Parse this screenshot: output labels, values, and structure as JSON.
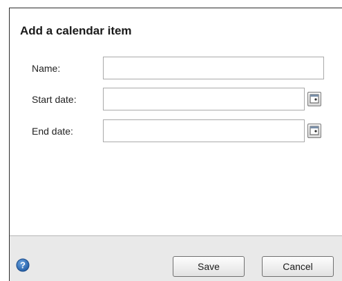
{
  "dialog": {
    "title": "Add a calendar item",
    "fields": {
      "name": {
        "label": "Name:",
        "value": ""
      },
      "start_date": {
        "label": "Start date:",
        "value": ""
      },
      "end_date": {
        "label": "End date:",
        "value": ""
      }
    },
    "buttons": {
      "save": "Save",
      "cancel": "Cancel"
    },
    "icons": {
      "help": "help-icon",
      "calendar": "calendar-icon"
    },
    "colors": {
      "footer": "#e9e9e9",
      "help_icon": "#2f6fb6"
    }
  }
}
